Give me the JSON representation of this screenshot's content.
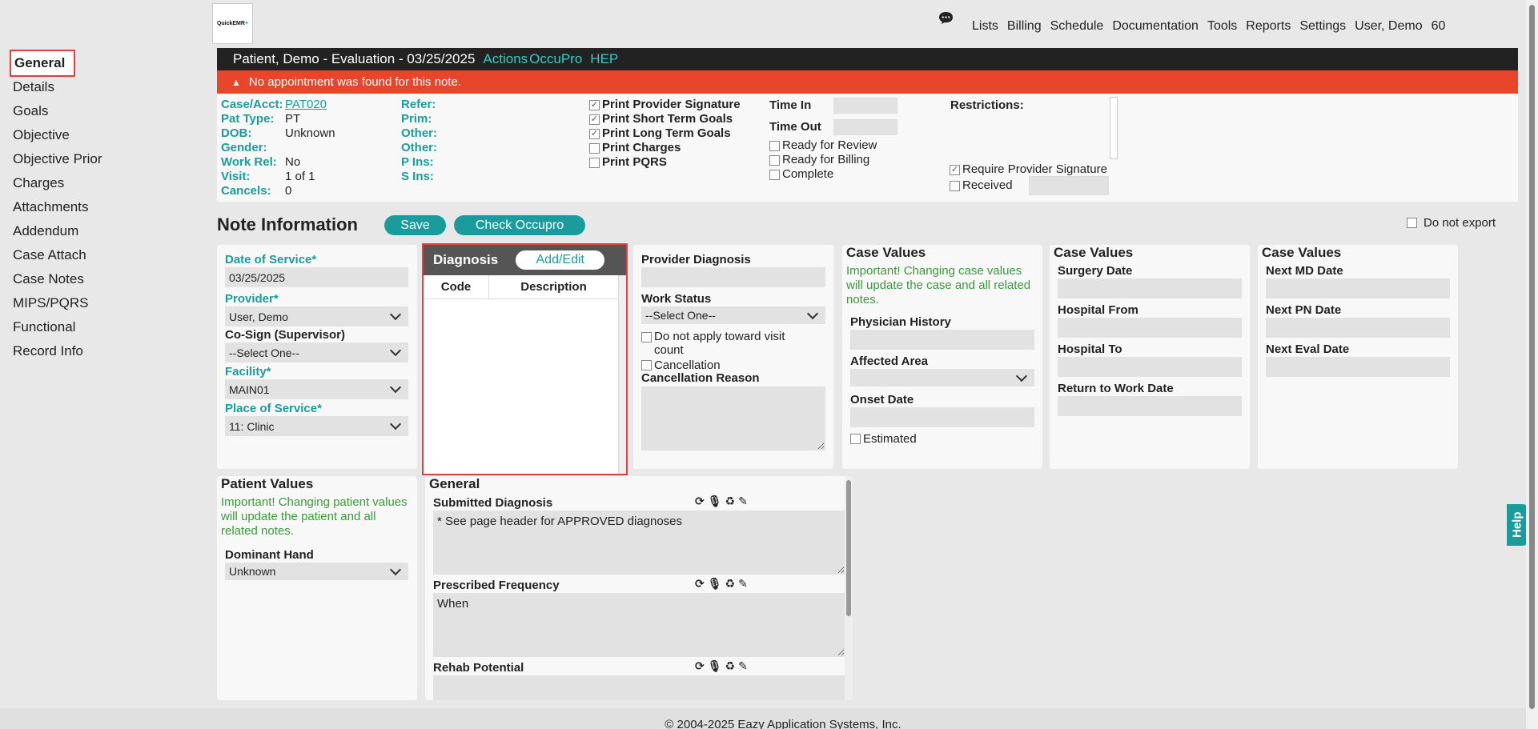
{
  "logo": {
    "l1": "QuickEMR",
    "l2": "+"
  },
  "topnav": [
    "Lists",
    "Billing",
    "Schedule",
    "Documentation",
    "Tools",
    "Reports",
    "Settings",
    "User, Demo",
    "60"
  ],
  "leftnav": [
    "General",
    "Details",
    "Goals",
    "Objective",
    "Objective Prior",
    "Charges",
    "Attachments",
    "Addendum",
    "Case Attach",
    "Case Notes",
    "MIPS/PQRS",
    "Functional",
    "Record Info"
  ],
  "header": {
    "title": "Patient, Demo - Evaluation - 03/25/2025",
    "actions": "Actions",
    "occupro": "OccuPro",
    "hep": "HEP"
  },
  "alert": "No appointment was found for this note.",
  "caseinfo": {
    "left": [
      {
        "label": "Case/Acct:",
        "value": "PAT020"
      },
      {
        "label": "Pat Type:",
        "value": "PT"
      },
      {
        "label": "DOB:",
        "value": "Unknown"
      },
      {
        "label": "Gender:",
        "value": ""
      },
      {
        "label": "Work Rel:",
        "value": "No"
      },
      {
        "label": "Visit:",
        "value": "1 of 1"
      },
      {
        "label": "Cancels:",
        "value": "0"
      }
    ],
    "mid": [
      "Refer:",
      "Prim:",
      "Other:",
      "Other:",
      "P Ins:",
      "S Ins:"
    ],
    "prints": [
      {
        "label": "Print Provider Signature",
        "checked": true
      },
      {
        "label": "Print Short Term Goals",
        "checked": true
      },
      {
        "label": "Print Long Term Goals",
        "checked": true
      },
      {
        "label": "Print Charges",
        "checked": false
      },
      {
        "label": "Print PQRS",
        "checked": false
      }
    ],
    "time_in": "Time In",
    "time_out": "Time Out",
    "status": [
      "Ready for Review",
      "Ready for Billing",
      "Complete"
    ],
    "restrictions": "Restrictions:",
    "require_sig": "Require Provider Signature",
    "received": "Received"
  },
  "noteinfo": {
    "title": "Note Information",
    "save": "Save",
    "check": "Check Occupro",
    "noexport": "Do not export"
  },
  "service": {
    "dos_label": "Date of Service*",
    "dos_value": "03/25/2025",
    "provider_label": "Provider*",
    "provider_value": "User, Demo",
    "cosign_label": "Co-Sign (Supervisor)",
    "cosign_value": "--Select One--",
    "facility_label": "Facility*",
    "facility_value": "MAIN01",
    "pos_label": "Place of Service*",
    "pos_value": "11: Clinic"
  },
  "diagnosis": {
    "title": "Diagnosis",
    "add": "Add/Edit",
    "col_code": "Code",
    "col_desc": "Description"
  },
  "provider_diag": {
    "label": "Provider Diagnosis",
    "work_status": "Work Status",
    "work_value": "--Select One--",
    "no_apply": "Do not apply toward visit count",
    "cancellation": "Cancellation",
    "cancel_reason": "Cancellation Reason"
  },
  "case_values_1": {
    "title": "Case Values",
    "warning": "Important! Changing case values will update the case and all related notes.",
    "phys": "Physician History",
    "affected": "Affected Area",
    "onset": "Onset Date",
    "estimated": "Estimated"
  },
  "case_values_2": {
    "title": "Case Values",
    "surgery": "Surgery Date",
    "hosp_from": "Hospital From",
    "hosp_to": "Hospital To",
    "rtw": "Return to Work Date"
  },
  "case_values_3": {
    "title": "Case Values",
    "next_md": "Next MD Date",
    "next_pn": "Next PN Date",
    "next_eval": "Next Eval Date"
  },
  "patient_values": {
    "title": "Patient Values",
    "warning": "Important! Changing patient values will update the patient and all related notes.",
    "hand_label": "Dominant Hand",
    "hand_value": "Unknown"
  },
  "general": {
    "title": "General",
    "submitted": "Submitted Diagnosis",
    "submitted_text": "* See page header for APPROVED diagnoses",
    "frequency": "Prescribed Frequency",
    "frequency_text": "When",
    "rehab": "Rehab Potential"
  },
  "help": "Help",
  "footer": "© 2004-2025 Eazy Application Systems, Inc.",
  "colors": {
    "teal": "#1a9c9c",
    "alert": "#e8452b",
    "header": "#222222",
    "highlight": "#e04040"
  }
}
